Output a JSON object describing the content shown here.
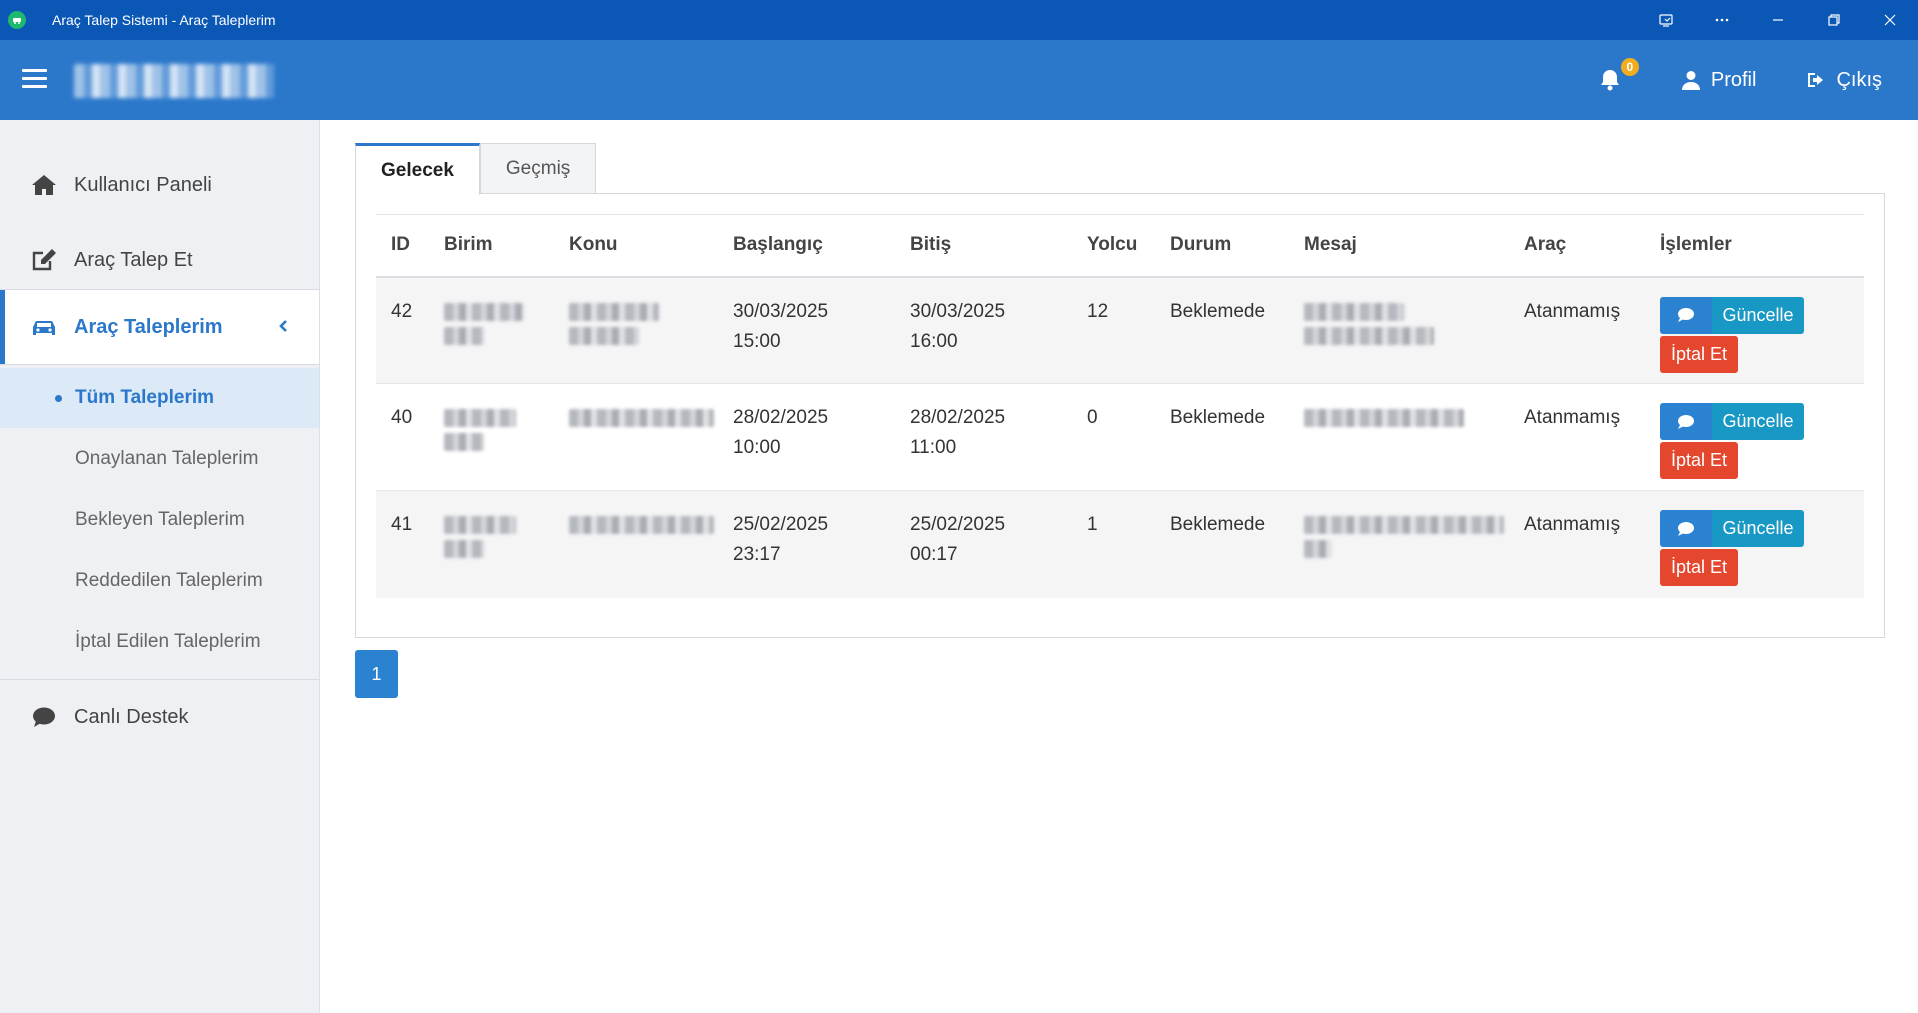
{
  "window": {
    "title": "Araç Talep Sistemi - Araç Taleplerim"
  },
  "header": {
    "notification_count": "0",
    "profile_label": "Profil",
    "logout_label": "Çıkış"
  },
  "sidebar": {
    "items": [
      {
        "label": "Kullanıcı Paneli",
        "icon": "home-icon"
      },
      {
        "label": "Araç Talep Et",
        "icon": "edit-icon"
      },
      {
        "label": "Araç Taleplerim",
        "icon": "car-icon"
      },
      {
        "label": "Canlı Destek",
        "icon": "chat-icon"
      }
    ],
    "sub_items": [
      {
        "label": "Tüm Taleplerim"
      },
      {
        "label": "Onaylanan Taleplerim"
      },
      {
        "label": "Bekleyen Taleplerim"
      },
      {
        "label": "Reddedilen Taleplerim"
      },
      {
        "label": "İptal Edilen Taleplerim"
      }
    ]
  },
  "tabs": [
    {
      "label": "Gelecek",
      "active": true
    },
    {
      "label": "Geçmiş",
      "active": false
    }
  ],
  "table": {
    "columns": [
      "ID",
      "Birim",
      "Konu",
      "Başlangıç",
      "Bitiş",
      "Yolcu",
      "Durum",
      "Mesaj",
      "Araç",
      "İşlemler"
    ],
    "rows": [
      {
        "id": "42",
        "start_date": "30/03/2025",
        "start_time": "15:00",
        "end_date": "30/03/2025",
        "end_time": "16:00",
        "passengers": "12",
        "status": "Beklemede",
        "vehicle": "Atanmamış"
      },
      {
        "id": "40",
        "start_date": "28/02/2025",
        "start_time": "10:00",
        "end_date": "28/02/2025",
        "end_time": "11:00",
        "passengers": "0",
        "status": "Beklemede",
        "vehicle": "Atanmamış"
      },
      {
        "id": "41",
        "start_date": "25/02/2025",
        "start_time": "23:17",
        "end_date": "25/02/2025",
        "end_time": "00:17",
        "passengers": "1",
        "status": "Beklemede",
        "vehicle": "Atanmamış"
      }
    ],
    "actions": {
      "update_label": "Güncelle",
      "cancel_label": "İptal Et"
    }
  },
  "pagination": {
    "current_page": "1"
  },
  "colors": {
    "titlebar": "#0a57b5",
    "header": "#2b78cb",
    "primary": "#2b82d0",
    "info": "#1898c4",
    "danger": "#e4472e",
    "badge": "#f0ad1e"
  }
}
